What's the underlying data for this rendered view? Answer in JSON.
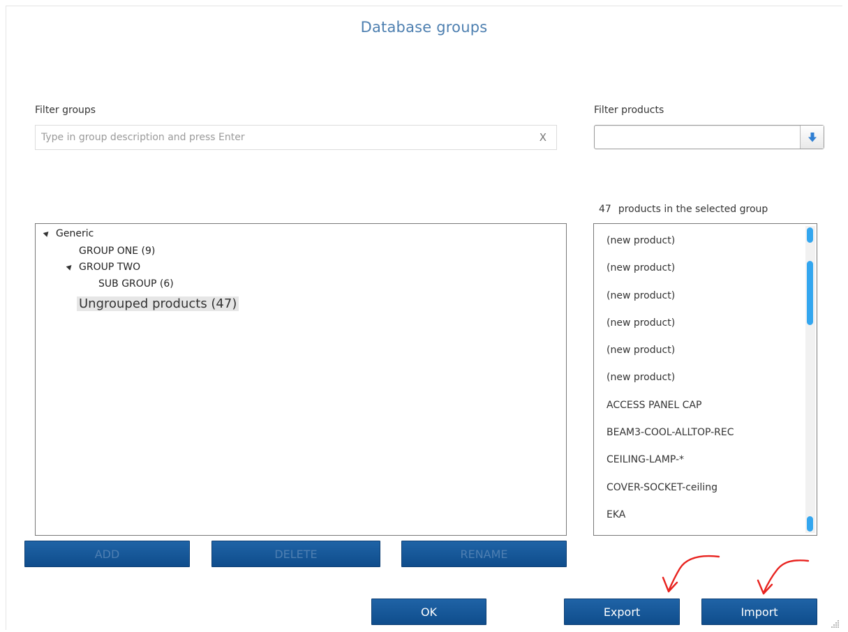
{
  "dialog": {
    "title": "Database groups"
  },
  "filter_groups": {
    "label": "Filter groups",
    "placeholder": "Type in group description and press Enter",
    "value": "",
    "clear_label": "X"
  },
  "filter_products": {
    "label": "Filter products",
    "selected": ""
  },
  "products": {
    "count": "47",
    "count_label": "products in the selected group",
    "items": [
      "(new product)",
      "(new product)",
      "(new product)",
      "(new product)",
      "(new product)",
      "(new product)",
      "ACCESS PANEL CAP",
      "BEAM3-COOL-ALLTOP-REC",
      "CEILING-LAMP-*",
      "COVER-SOCKET-ceiling",
      "EKA"
    ]
  },
  "tree": {
    "nodes": [
      {
        "label": "Generic",
        "expanded": true
      },
      {
        "label": "GROUP ONE (9)"
      },
      {
        "label": "GROUP TWO",
        "expanded": true
      },
      {
        "label": "SUB GROUP (6)"
      },
      {
        "label": "Ungrouped products (47)",
        "selected": true
      }
    ]
  },
  "group_buttons": {
    "add": "ADD",
    "delete": "DELETE",
    "rename": "RENAME"
  },
  "footer_buttons": {
    "ok": "OK",
    "export": "Export",
    "import": "Import"
  },
  "icons": {
    "combo_dropdown": "arrow-down-icon",
    "resize": "resize-grip-icon",
    "annotation": "red-arrow-icon"
  },
  "colors": {
    "title": "#4d7fb0",
    "button": "#165a9c",
    "scrollbar": "#33a6ef",
    "annotation": "#e8231f"
  }
}
